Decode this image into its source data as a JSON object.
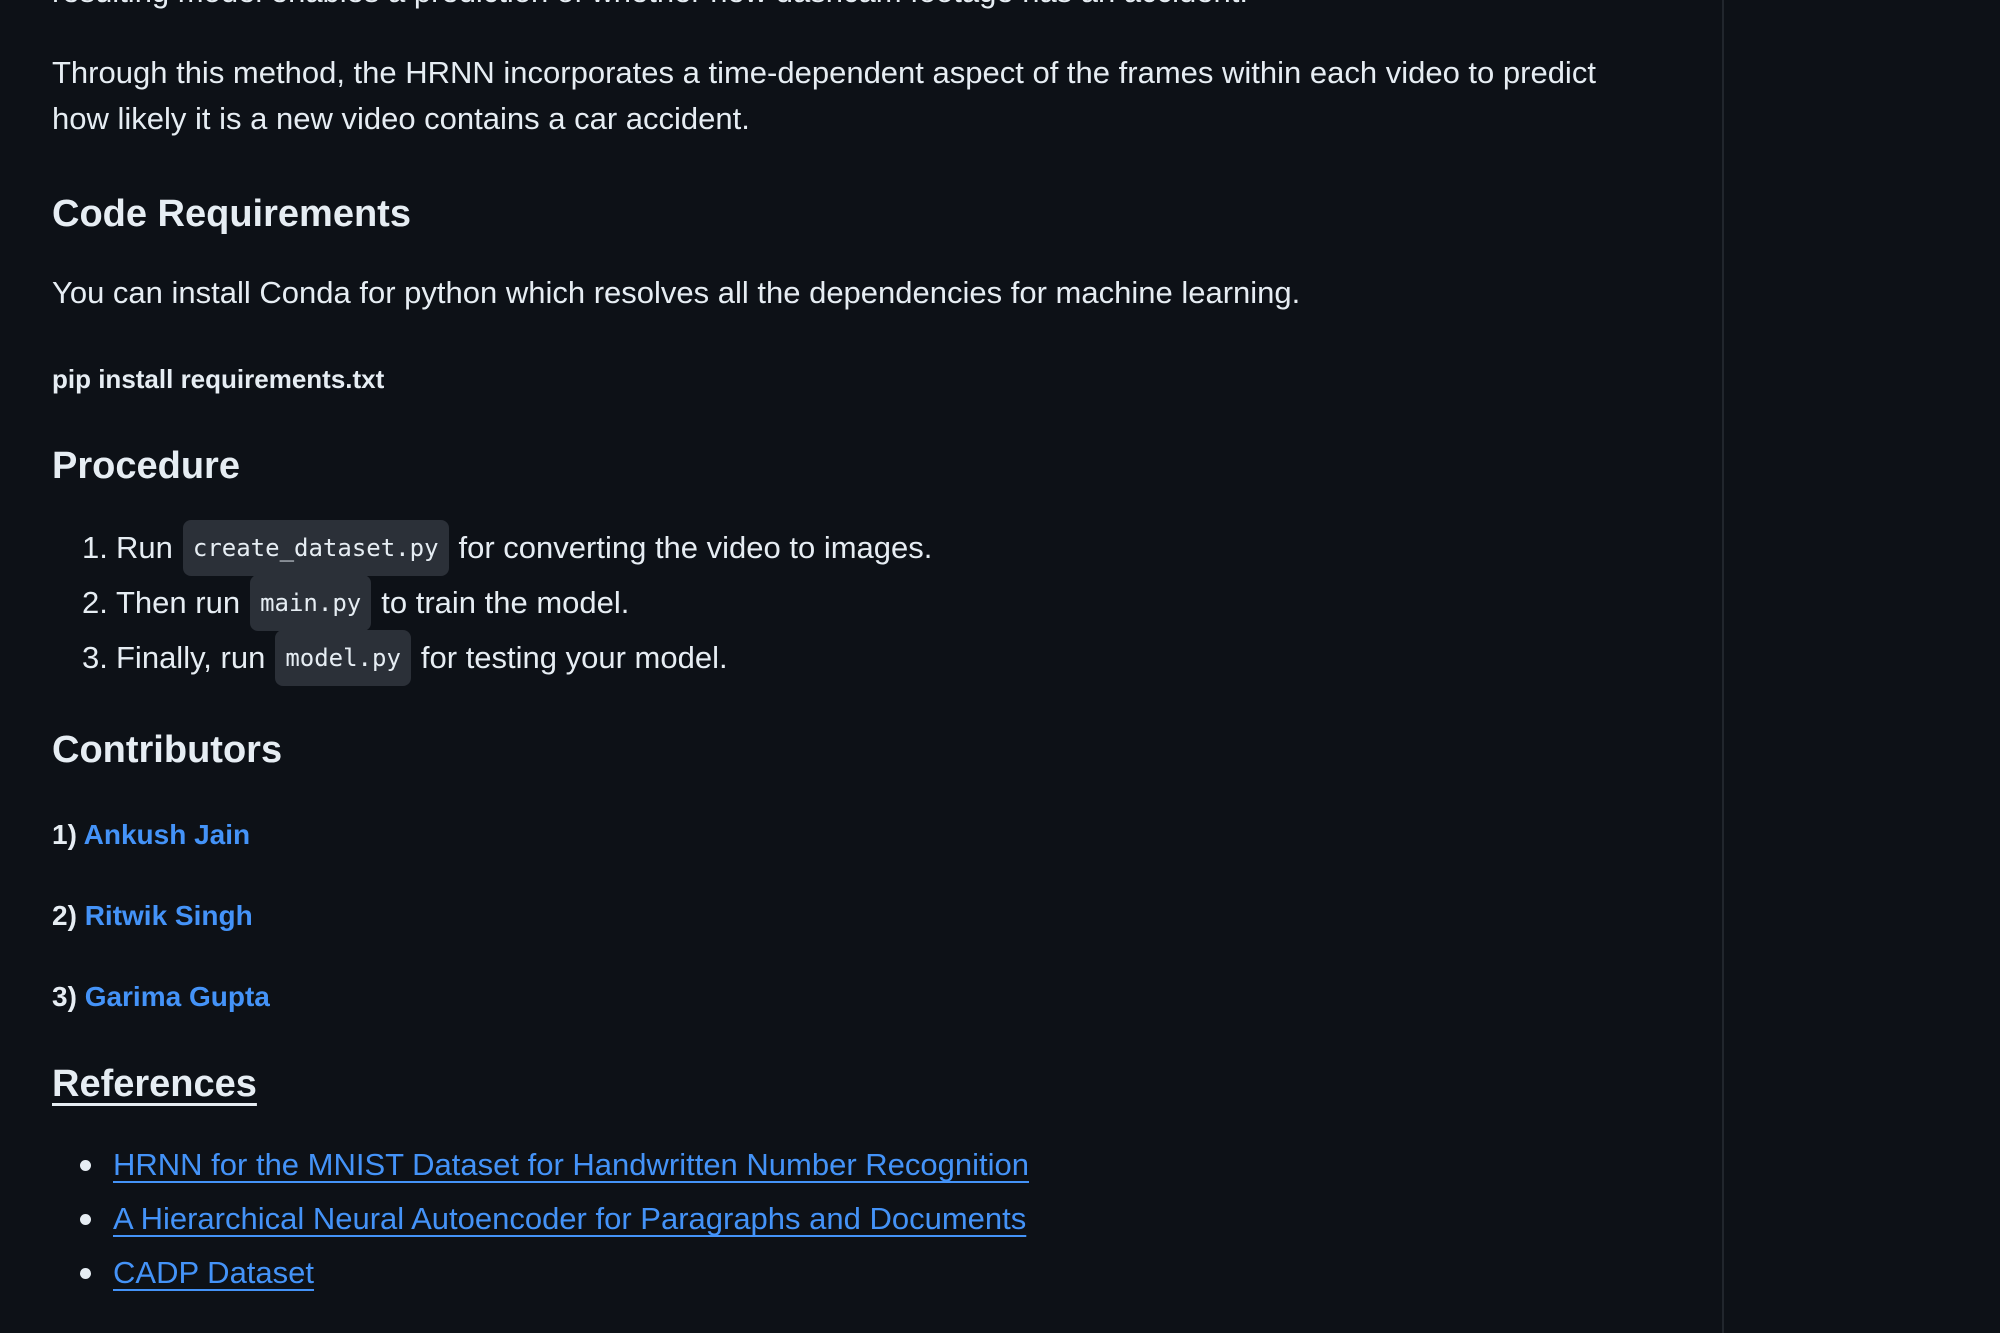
{
  "readme": {
    "cut_line": "resulting model enables a prediction of whether new dashcam footage has an accident.",
    "intro_paragraph_line1": "Through this method, the HRNN incorporates a time-dependent aspect of the frames within each video to predict",
    "intro_paragraph_line2": "how likely it is a new video contains a car accident.",
    "code_requirements": {
      "heading": "Code Requirements",
      "text": "You can install Conda for python which resolves all the dependencies for machine learning.",
      "command": "pip install requirements.txt"
    },
    "procedure": {
      "heading": "Procedure",
      "steps": [
        {
          "num": "1.",
          "before": "Run",
          "code": "create_dataset.py",
          "after": "for converting the video to images."
        },
        {
          "num": "2.",
          "before": "Then run",
          "code": "main.py",
          "after": "to train the model."
        },
        {
          "num": "3.",
          "before": "Finally, run",
          "code": "model.py",
          "after": "for testing your model."
        }
      ]
    },
    "contributors": {
      "heading": "Contributors",
      "items": [
        {
          "num": "1)",
          "name": "Ankush Jain"
        },
        {
          "num": "2)",
          "name": "Ritwik Singh"
        },
        {
          "num": "3)",
          "name": "Garima Gupta"
        }
      ]
    },
    "references": {
      "heading": "References",
      "items": [
        {
          "label": "HRNN for the MNIST Dataset for Handwritten Number Recognition"
        },
        {
          "label": "A Hierarchical Neural Autoencoder for Paragraphs and Documents"
        },
        {
          "label": "CADP Dataset"
        }
      ]
    }
  },
  "colors": {
    "background": "#0d1117",
    "text": "#e6edf3",
    "link": "#4493f8",
    "code_bg": "#2b3038",
    "divider": "#21262d"
  }
}
